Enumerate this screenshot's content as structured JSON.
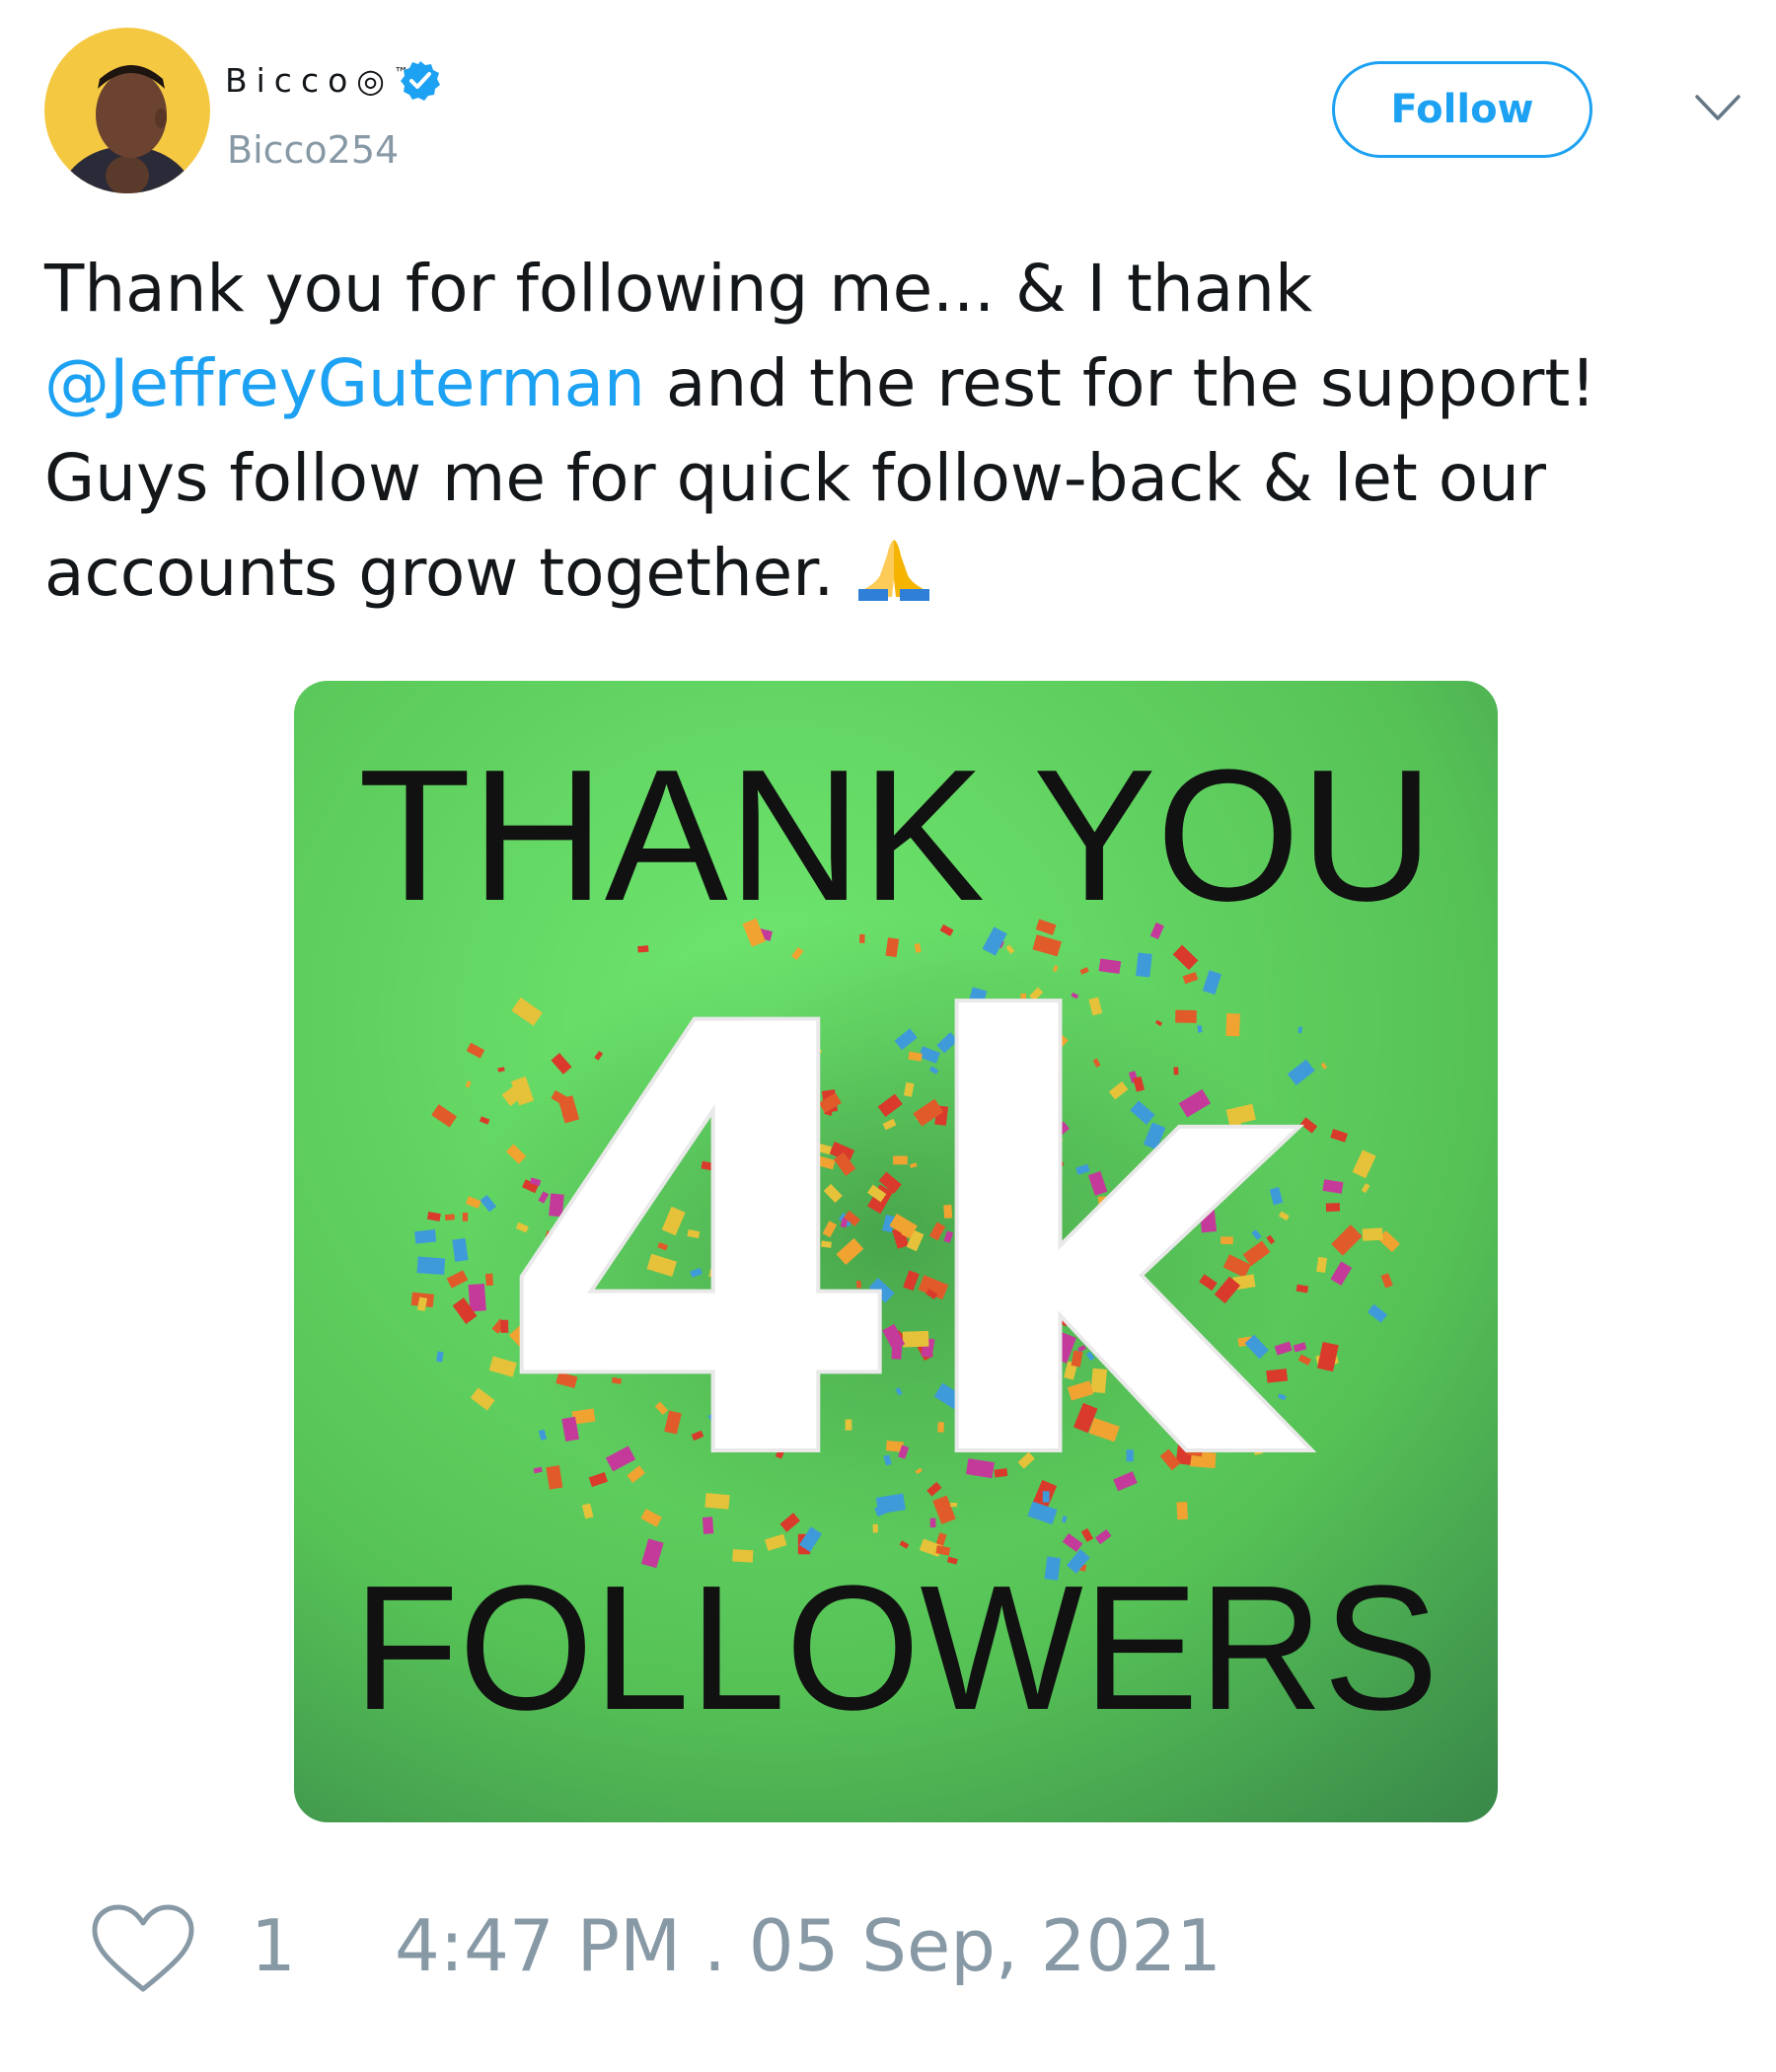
{
  "author": {
    "display_name": "Bicco◎",
    "trademark": "™",
    "handle": "Bicco254",
    "verified_icon": "verified-badge-icon",
    "avatar_icon": "avatar-photo"
  },
  "header": {
    "follow_label": "Follow",
    "menu_icon": "chevron-down-icon"
  },
  "tweet": {
    "text_part1": "Thank you for following me... & I thank ",
    "mention": "@JeffreyGuterman",
    "text_part2": " and the rest for the support! Guys follow me for quick follow-back & let our accounts grow together. ",
    "emoji": "folded-hands-emoji"
  },
  "media": {
    "line1": "THANK YOU",
    "big": "4k",
    "line2": "FOLLOWERS",
    "background_color": "#5fcf5f"
  },
  "footer": {
    "like_icon": "heart-outline-icon",
    "like_count": "1",
    "timestamp": "4:47 PM . 05 Sep, 2021"
  },
  "colors": {
    "accent": "#1da1f2",
    "muted": "#8899a6",
    "text": "#14171a"
  }
}
